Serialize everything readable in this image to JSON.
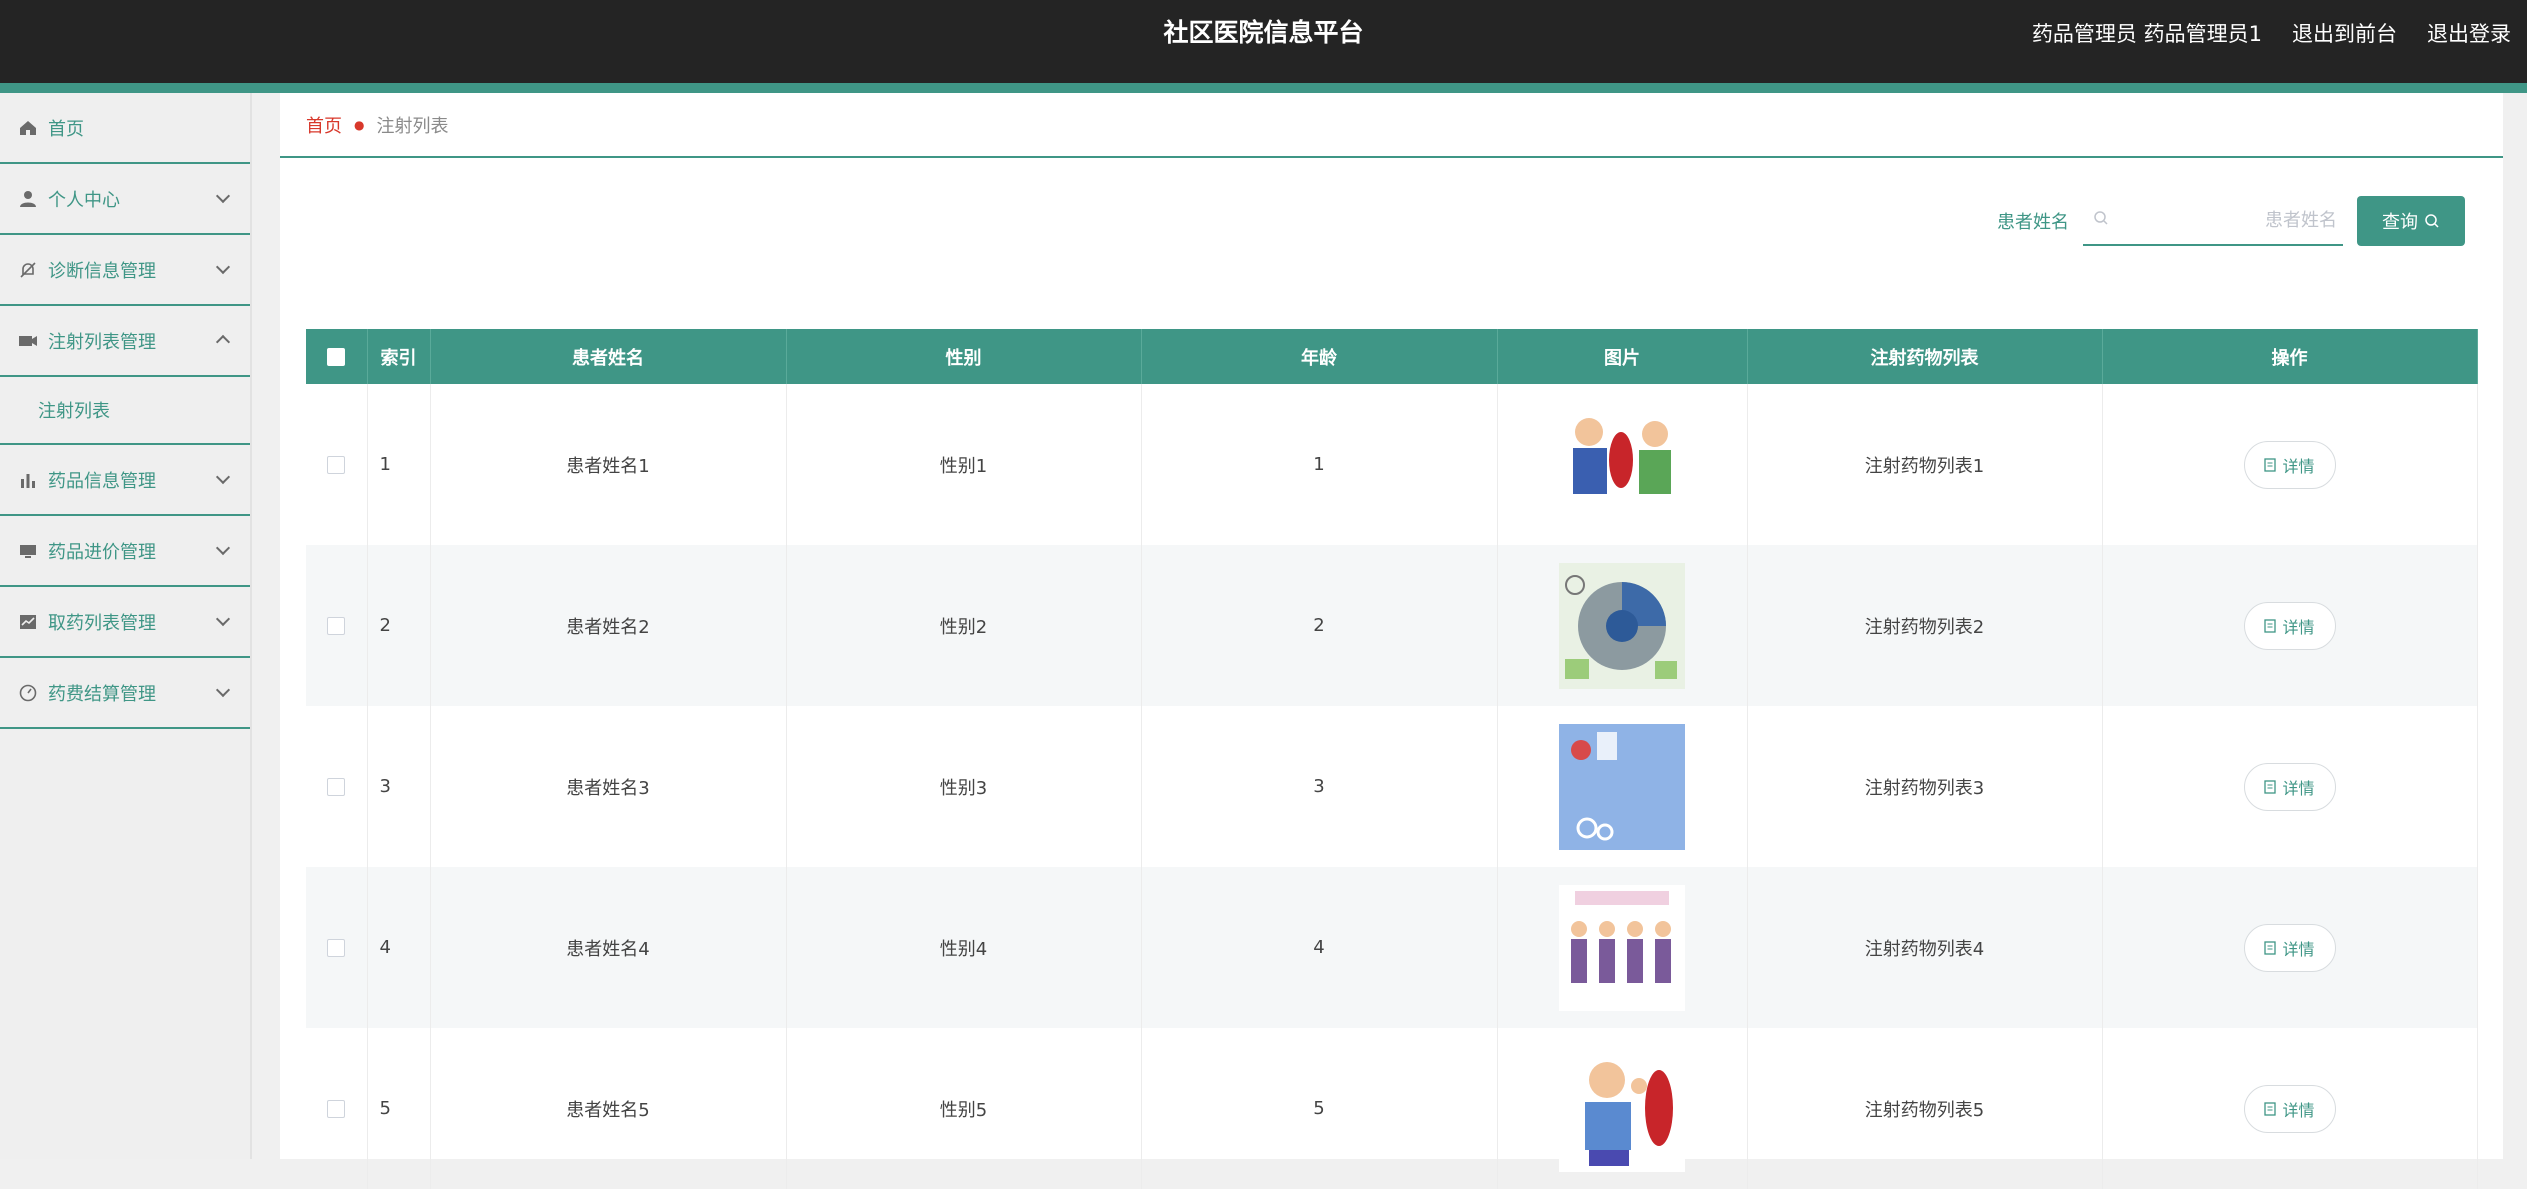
{
  "header": {
    "app_title": "社区医院信息平台",
    "role": "药品管理员",
    "username": "药品管理员1",
    "front_link": "退出到前台",
    "logout_link": "退出登录"
  },
  "sidebar": {
    "items": [
      {
        "label": "首页",
        "icon": "home-icon"
      },
      {
        "label": "个人中心",
        "icon": "user-icon"
      },
      {
        "label": "诊断信息管理",
        "icon": "bell-off-icon"
      },
      {
        "label": "注射列表管理",
        "icon": "ticket-icon"
      },
      {
        "label": "药品信息管理",
        "icon": "bar-chart-icon"
      },
      {
        "label": "药品进价管理",
        "icon": "monitor-icon"
      },
      {
        "label": "取药列表管理",
        "icon": "line-chart-icon"
      },
      {
        "label": "药费结算管理",
        "icon": "gauge-icon"
      }
    ],
    "sub_item": "注射列表"
  },
  "breadcrumb": {
    "home": "首页",
    "current": "注射列表"
  },
  "search": {
    "label": "患者姓名",
    "placeholder": "患者姓名",
    "button": "查询"
  },
  "table": {
    "headers": [
      "索引",
      "患者姓名",
      "性别",
      "年龄",
      "图片",
      "注射药物列表",
      "操作"
    ],
    "rows": [
      {
        "index": "1",
        "name": "患者姓名1",
        "gender": "性别1",
        "age": "1",
        "drugs": "注射药物列表1",
        "action": "详情"
      },
      {
        "index": "2",
        "name": "患者姓名2",
        "gender": "性别2",
        "age": "2",
        "drugs": "注射药物列表2",
        "action": "详情"
      },
      {
        "index": "3",
        "name": "患者姓名3",
        "gender": "性别3",
        "age": "3",
        "drugs": "注射药物列表3",
        "action": "详情"
      },
      {
        "index": "4",
        "name": "患者姓名4",
        "gender": "性别4",
        "age": "4",
        "drugs": "注射药物列表4",
        "action": "详情"
      },
      {
        "index": "5",
        "name": "患者姓名5",
        "gender": "性别5",
        "age": "5",
        "drugs": "注射药物列表5",
        "action": "详情"
      }
    ]
  },
  "colors": {
    "accent": "#3f9686",
    "header_bg": "#242424",
    "breadcrumb_home": "#d8382b"
  }
}
